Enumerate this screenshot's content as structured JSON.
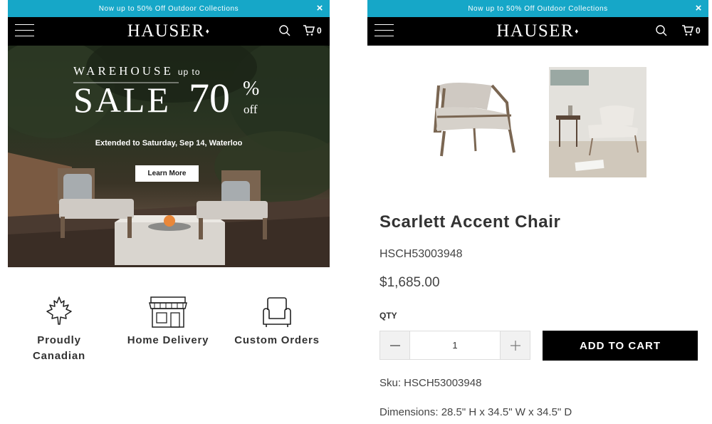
{
  "promo_banner": {
    "text": "Now up to 50% Off Outdoor Collections",
    "close_icon": "×"
  },
  "header": {
    "logo": "HAUSER",
    "logo_leaf": "♦",
    "cart_count": "0"
  },
  "hero": {
    "title_line1": "WAREHOUSE",
    "title_upto": "up to",
    "title_sale": "SALE",
    "title_percent": "70",
    "title_percent_sign": "%",
    "title_off": "off",
    "subtitle": "Extended to Saturday, Sep 14, Waterloo",
    "button_label": "Learn More"
  },
  "features": [
    {
      "icon": "maple-leaf-icon",
      "label_line1": "Proudly",
      "label_line2": "Canadian"
    },
    {
      "icon": "storefront-icon",
      "label_line1": "Home Delivery",
      "label_line2": ""
    },
    {
      "icon": "armchair-icon",
      "label_line1": "Custom Orders",
      "label_line2": ""
    }
  ],
  "product": {
    "name": "Scarlett Accent Chair",
    "code": "HSCH53003948",
    "price": "$1,685.00",
    "qty_label": "QTY",
    "qty_value": "1",
    "add_to_cart_label": "ADD TO CART",
    "sku": "Sku: HSCH53003948",
    "dimensions": "Dimensions: 28.5\" H x 34.5\" W x 34.5\" D"
  },
  "colors": {
    "promo_bg": "#16a7c8",
    "nav_bg": "#000000",
    "button_bg": "#000000"
  }
}
